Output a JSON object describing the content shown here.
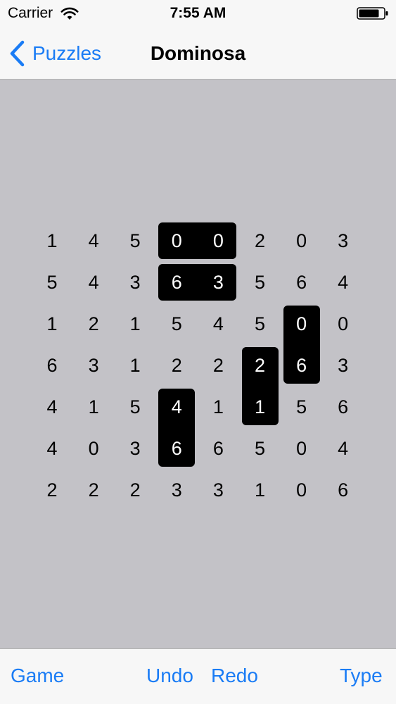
{
  "status_bar": {
    "carrier": "Carrier",
    "time": "7:55 AM"
  },
  "nav": {
    "back_label": "Puzzles",
    "title": "Dominosa"
  },
  "grid": [
    [
      1,
      4,
      5,
      0,
      0,
      2,
      0,
      3
    ],
    [
      5,
      4,
      3,
      6,
      3,
      5,
      6,
      4
    ],
    [
      1,
      2,
      1,
      5,
      4,
      5,
      0,
      0
    ],
    [
      6,
      3,
      1,
      2,
      2,
      2,
      6,
      3
    ],
    [
      4,
      1,
      5,
      4,
      1,
      1,
      5,
      6
    ],
    [
      4,
      0,
      3,
      6,
      6,
      5,
      0,
      4
    ],
    [
      2,
      2,
      2,
      3,
      3,
      1,
      0,
      6
    ]
  ],
  "placed_dominoes": [
    {
      "cells": [
        [
          0,
          3
        ],
        [
          0,
          4
        ]
      ]
    },
    {
      "cells": [
        [
          1,
          3
        ],
        [
          1,
          4
        ]
      ]
    },
    {
      "cells": [
        [
          2,
          6
        ],
        [
          3,
          6
        ]
      ]
    },
    {
      "cells": [
        [
          3,
          5
        ],
        [
          4,
          5
        ]
      ]
    },
    {
      "cells": [
        [
          4,
          3
        ],
        [
          5,
          3
        ]
      ]
    }
  ],
  "toolbar": {
    "game_label": "Game",
    "undo_label": "Undo",
    "redo_label": "Redo",
    "type_label": "Type"
  },
  "colors": {
    "accent": "#1a7cf5",
    "board_background": "#c3c2c7",
    "bar_background": "#f7f7f7",
    "domino": "#000000"
  }
}
